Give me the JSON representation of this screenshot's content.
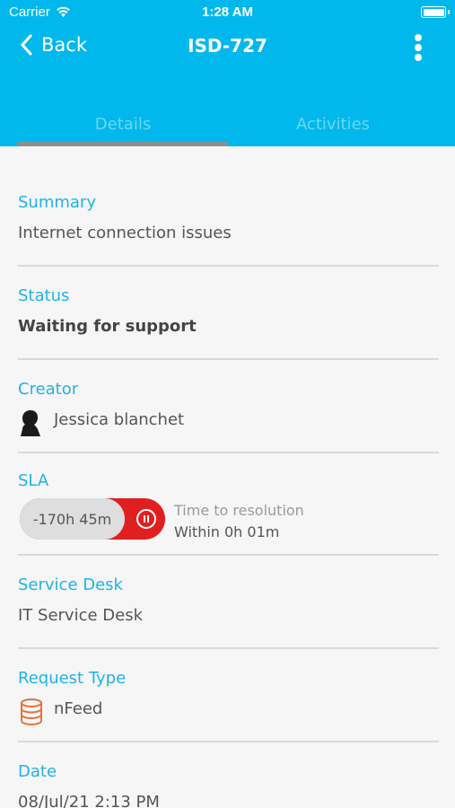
{
  "status_bar": {
    "carrier": "Carrier",
    "time": "1:28 AM"
  },
  "nav": {
    "back_label": "Back",
    "title": "ISD-727"
  },
  "tabs": [
    {
      "label": "Details",
      "active": true
    },
    {
      "label": "Activities",
      "active": false
    }
  ],
  "fields": {
    "summary": {
      "label": "Summary",
      "value": "Internet connection issues"
    },
    "status": {
      "label": "Status",
      "value": "Waiting for support"
    },
    "creator": {
      "label": "Creator",
      "value": "Jessica blanchet",
      "icon": "person-silhouette-icon"
    },
    "sla": {
      "label": "SLA",
      "elapsed": "-170h 45m",
      "caption": "Time to resolution",
      "within": "Within 0h 01m",
      "state": "paused",
      "icon": "pause-icon"
    },
    "service_desk": {
      "label": "Service Desk",
      "value": "IT Service Desk"
    },
    "request_type": {
      "label": "Request Type",
      "value": "nFeed",
      "icon": "database-icon"
    },
    "date": {
      "label": "Date",
      "value": "08/Jul/21 2:13 PM"
    }
  },
  "colors": {
    "header": "#00b8ec",
    "accent_label": "#1fb3e5",
    "sla_overdue": "#e02020",
    "request_icon": "#e8713a"
  }
}
